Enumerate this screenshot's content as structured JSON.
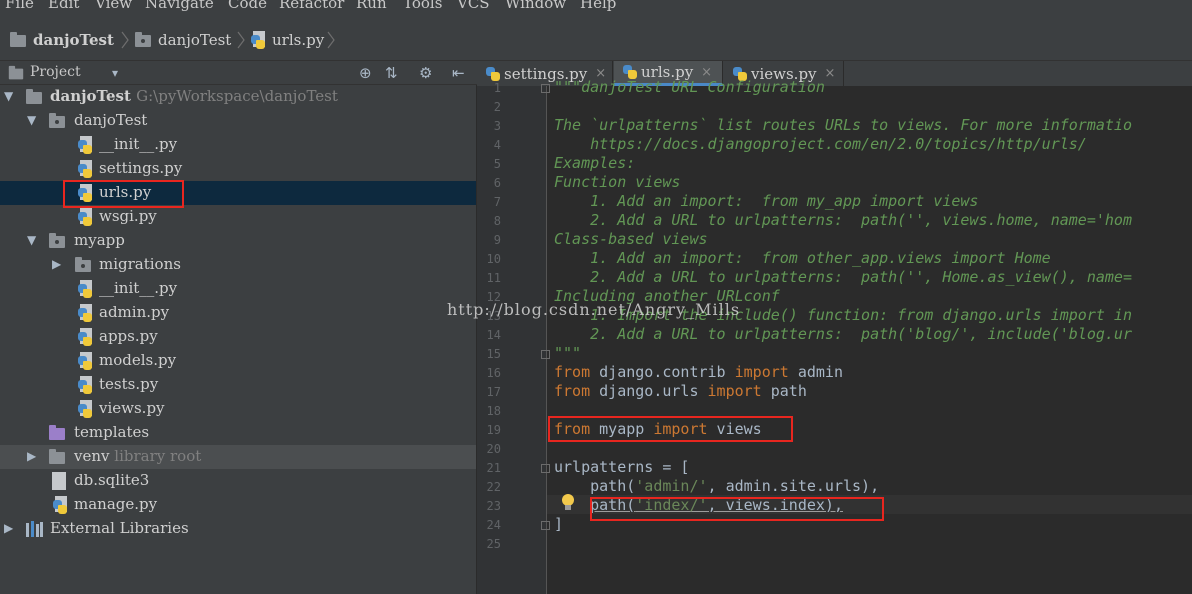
{
  "menu": [
    "File",
    "Edit",
    "View",
    "Navigate",
    "Code",
    "Refactor",
    "Run",
    "Tools",
    "VCS",
    "Window",
    "Help"
  ],
  "breadcrumb": [
    "danjoTest",
    "danjoTest",
    "urls.py"
  ],
  "project_panel": {
    "title": "Project",
    "dropdown_arrow": "▾",
    "tools": [
      "⊕",
      "⇅",
      "⚙",
      "⇤"
    ]
  },
  "tree": {
    "root_name": "danjoTest",
    "root_path": "G:\\pyWorkspace\\danjoTest",
    "pkg1": "danjoTest",
    "init1": "__init__.py",
    "settings": "settings.py",
    "urls": "urls.py",
    "wsgi": "wsgi.py",
    "pkg2": "myapp",
    "migrations": "migrations",
    "init2": "__init__.py",
    "admin": "admin.py",
    "apps": "apps.py",
    "models": "models.py",
    "tests": "tests.py",
    "views": "views.py",
    "templates": "templates",
    "venv": "venv",
    "venv_hint": "library root",
    "db": "db.sqlite3",
    "manage": "manage.py",
    "ext": "External Libraries"
  },
  "tabs": [
    {
      "label": "settings.py",
      "close": "×"
    },
    {
      "label": "urls.py",
      "close": "×"
    },
    {
      "label": "views.py",
      "close": "×"
    }
  ],
  "line_numbers": [
    "1",
    "2",
    "3",
    "4",
    "5",
    "6",
    "7",
    "8",
    "9",
    "10",
    "11",
    "12",
    "13",
    "14",
    "15",
    "16",
    "17",
    "18",
    "19",
    "20",
    "21",
    "22",
    "23",
    "24",
    "25"
  ],
  "code": {
    "l1": "\"\"\"danjoTest URL Configuration",
    "l3": "The `urlpatterns` list routes URLs to views. For more informatio",
    "l4": "    https://docs.djangoproject.com/en/2.0/topics/http/urls/",
    "l5": "Examples:",
    "l6": "Function views",
    "l7": "    1. Add an import:  from my_app import views",
    "l8": "    2. Add a URL to urlpatterns:  path('', views.home, name='hom",
    "l9": "Class-based views",
    "l10": "    1. Add an import:  from other_app.views import Home",
    "l11": "    2. Add a URL to urlpatterns:  path('', Home.as_view(), name=",
    "l12": "Including another URLconf",
    "l13": "    1. Import the include() function: from django.urls import in",
    "l14": "    2. Add a URL to urlpatterns:  path('blog/', include('blog.ur",
    "l15": "\"\"\"",
    "from": "from",
    "import": "import",
    "l16_mod": " django.contrib ",
    "l16_name": " admin",
    "l17_mod": " django.urls ",
    "l17_name": " path",
    "l19_mod": " myapp ",
    "l19_name": " views",
    "l21": "urlpatterns = [",
    "path": "    path(",
    "l22_str": "'admin/'",
    "l22_rest": ", admin.site.urls),",
    "l23_path": "path(",
    "l23_str": "'index/'",
    "l23_rest": ", views.index),",
    "l24": "]"
  },
  "watermark": "http://blog.csdn.net/Angry_Mills"
}
